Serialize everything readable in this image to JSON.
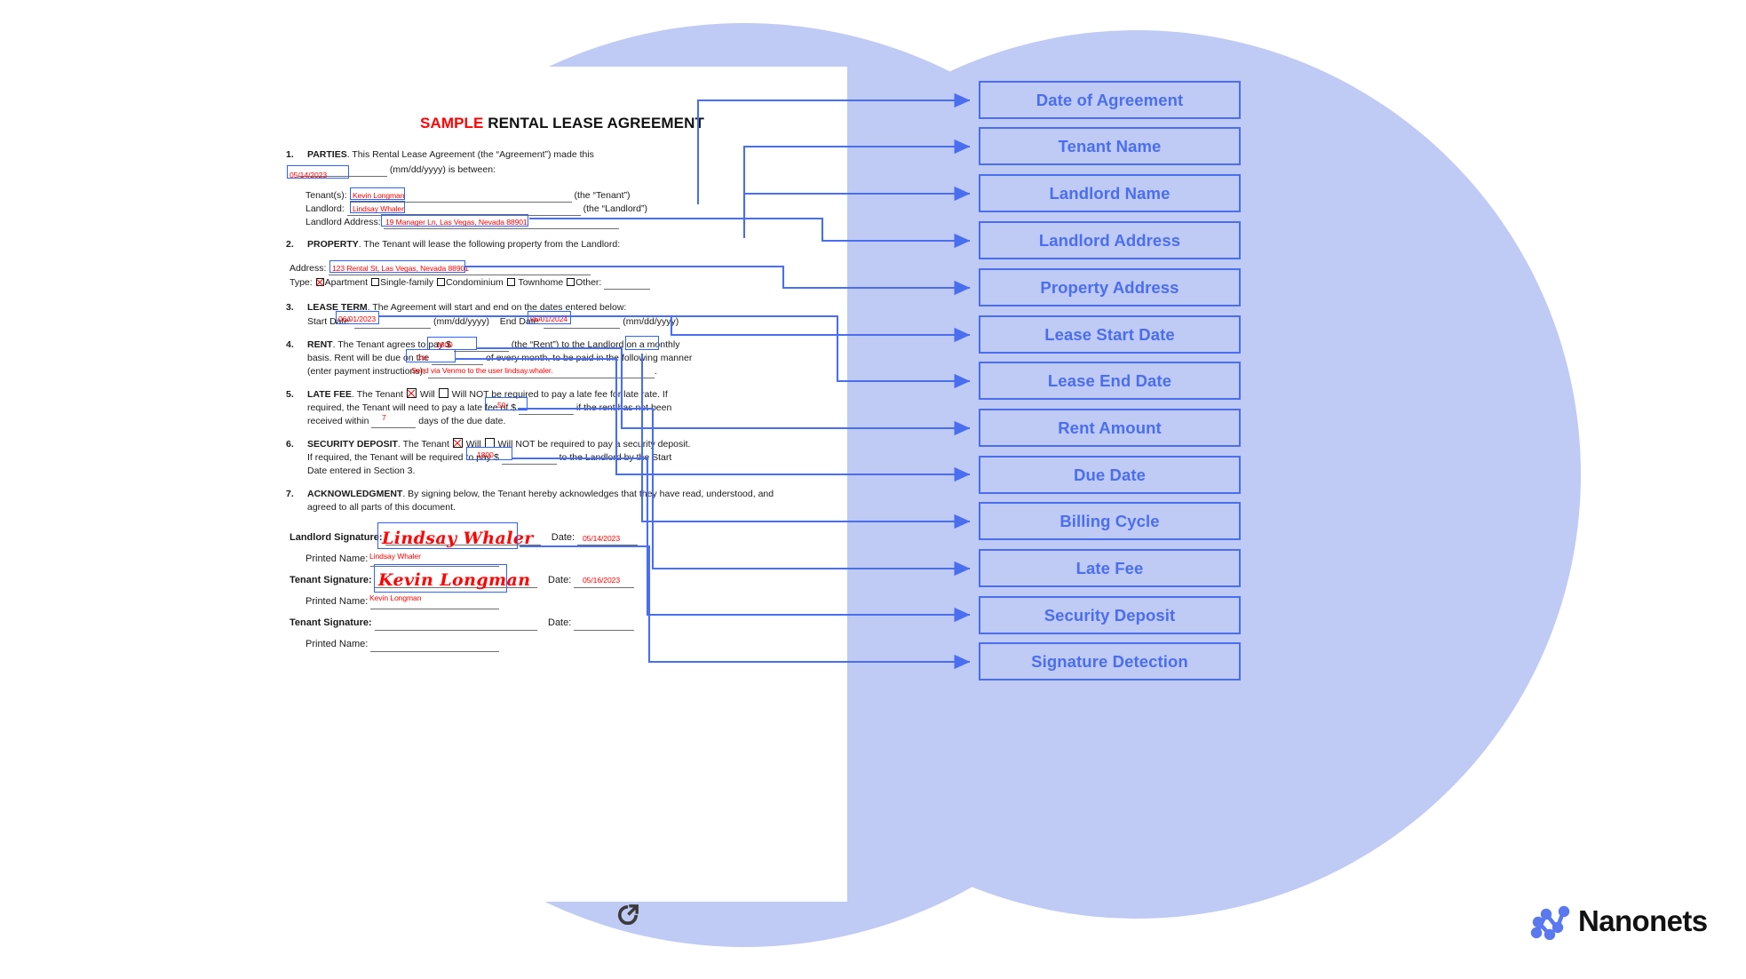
{
  "document": {
    "title_sample": "SAMPLE",
    "title_rest": " RENTAL LEASE AGREEMENT",
    "clauses": [
      {
        "num": "1.",
        "heading": "PARTIES",
        "text": ". This Rental Lease Agreement (the “Agreement”) made this",
        "line2_suffix": "(mm/dd/yyyy) is between:"
      },
      {
        "num": "2.",
        "heading": "PROPERTY",
        "text": ". The Tenant will lease the following property from the Landlord:"
      },
      {
        "num": "3.",
        "heading": "LEASE TERM",
        "text": ". The Agreement will start and end on the dates entered below:"
      },
      {
        "num": "4.",
        "heading": "RENT",
        "text": ". The Tenant agrees to pay"
      },
      {
        "num": "5.",
        "heading": "LATE FEE",
        "text": ". The Tenant"
      },
      {
        "num": "6.",
        "heading": "SECURITY DEPOSIT",
        "text": ". The Tenant"
      },
      {
        "num": "7.",
        "heading": "ACKNOWLEDGMENT",
        "text": ". By signing below, the Tenant hereby acknowledges that they have read, understood, and agreed to all parts of this document."
      }
    ],
    "labels": {
      "tenants": "Tenant(s):",
      "the_tenant": "(the “Tenant”)",
      "landlord": "Landlord:",
      "the_landlord": "(the “Landlord”)",
      "landlord_address": "Landlord Address:",
      "address": "Address:",
      "type": "Type:",
      "type_apartment": "Apartment",
      "type_single": "Single-family",
      "type_condo": "Condominium",
      "type_townhome": "Townhome",
      "type_other": "Other:",
      "start_date": "Start Date:",
      "end_date": "End Date:",
      "mmddyyyy": "(mm/dd/yyyy)",
      "rent_mid": "(the “Rent”) to the Landlord on a",
      "rent_basis": "basis. Rent will be due on the",
      "rent_due_tail": "of every month, to be paid in the following manner",
      "rent_instructions": "(enter payment instructions):",
      "late_will": "Will",
      "late_willnot": "Will NOT be required to pay a late fee for late rate. If",
      "late_line2": "required, the Tenant will need to pay a late fee of",
      "late_line2_tail": "if the rent has not been",
      "late_line3a": "received within",
      "late_line3b": "days of the due date.",
      "sd_willnot": "Will NOT be required to pay a security deposit.",
      "sd_line2": "If required, the Tenant will be required to pay",
      "sd_line2_tail": "to the Landlord by the Start",
      "sd_line3": "Date entered in Section 3.",
      "landlord_signature": "Landlord Signature:",
      "tenant_signature": "Tenant Signature:",
      "printed_name": "Printed Name:",
      "date": "Date:",
      "dollar": "$"
    },
    "values": {
      "agreement_date": "05/14/2023",
      "tenant_name": "Kevin Longman",
      "landlord_name": "Lindsay Whaler",
      "landlord_address": "19 Manager Ln, Las Vegas, Nevada 88901",
      "property_address": "123 Rental St, Las Vegas, Nevada 88901",
      "lease_start": "06/01/2023",
      "lease_end": "06/01/2024",
      "rent_amount": "1800",
      "due_day": "1st",
      "billing_cycle": "monthly",
      "payment_instructions": "Send via Venmo to the user lindsay.whaler.",
      "late_fee": "50",
      "late_days": "7",
      "security_deposit": "1800",
      "landlord_sig": "Lindsay Whaler",
      "landlord_sig_date": "05/14/2023",
      "landlord_printed": "Lindsay Whaler",
      "tenant_sig": "Kevin Longman",
      "tenant_sig_date": "05/16/2023",
      "tenant_printed": "Kevin Longman"
    }
  },
  "extraction_labels": [
    {
      "label": "Date of Agreement"
    },
    {
      "label": "Tenant Name"
    },
    {
      "label": "Landlord Name"
    },
    {
      "label": "Landlord Address"
    },
    {
      "label": "Property Address"
    },
    {
      "label": "Lease Start Date"
    },
    {
      "label": "Lease End Date"
    },
    {
      "label": "Rent Amount"
    },
    {
      "label": "Due Date"
    },
    {
      "label": "Billing Cycle"
    },
    {
      "label": "Late Fee"
    },
    {
      "label": "Security Deposit"
    },
    {
      "label": "Signature Detection"
    }
  ],
  "brand": {
    "name": "Nanonets",
    "logo_icon": "nanonets-node-logo"
  },
  "icons": {
    "refresh": "refresh-rotate-icon"
  },
  "colors": {
    "accent_blue": "#4a6ef0",
    "box_blue": "#2f63f0",
    "blob_lavender": "#bfcaf5",
    "value_red": "#ff0000",
    "logo_blue": "#5a78f0"
  }
}
